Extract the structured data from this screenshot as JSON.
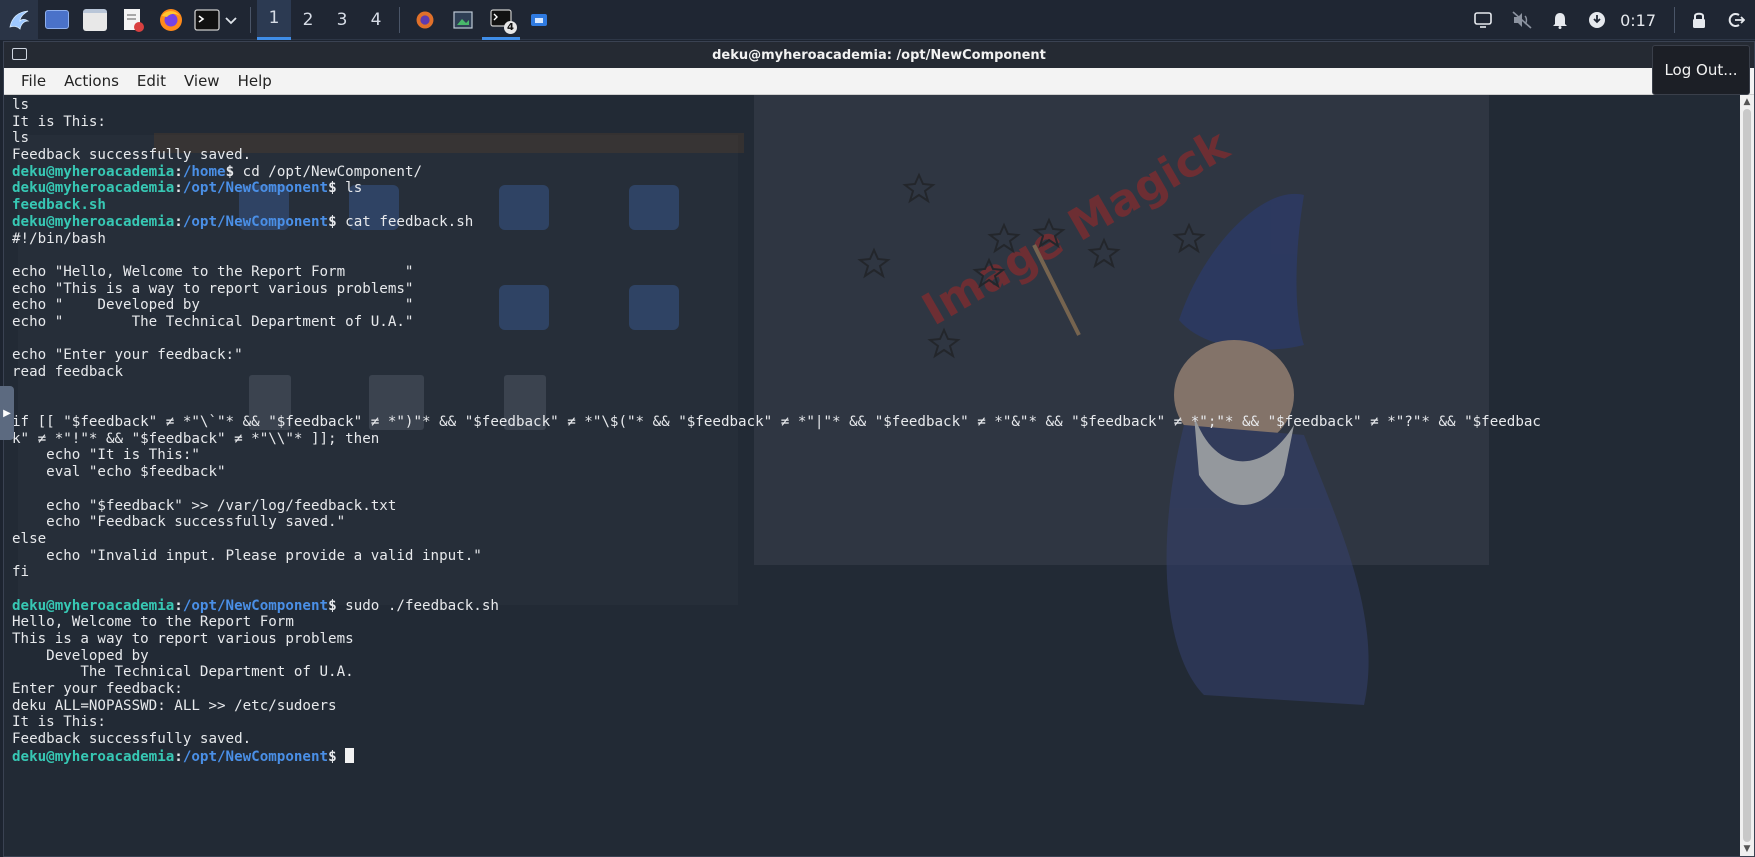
{
  "taskbar": {
    "workspaces": [
      "1",
      "2",
      "3",
      "4"
    ],
    "active_workspace": "1",
    "window_badge": "4",
    "clock": "0:17",
    "accent": "#3f8de8"
  },
  "window": {
    "title": "deku@myheroacademia: /opt/NewComponent",
    "menu": [
      "File",
      "Actions",
      "Edit",
      "View",
      "Help"
    ]
  },
  "tooltip": {
    "text": "Log Out..."
  },
  "wallpaper_text": "Image Magick",
  "terminal": {
    "prompt_user": "deku@myheroacademia",
    "lines": [
      {
        "type": "text",
        "text": "ls"
      },
      {
        "type": "text",
        "text": "It is This:"
      },
      {
        "type": "text",
        "text": "ls"
      },
      {
        "type": "text",
        "text": "Feedback successfully saved."
      },
      {
        "type": "prompt",
        "path": "/home",
        "cmd": "cd /opt/NewComponent/"
      },
      {
        "type": "prompt",
        "path": "/opt/NewComponent",
        "cmd": "ls"
      },
      {
        "type": "file",
        "text": "feedback.sh"
      },
      {
        "type": "prompt",
        "path": "/opt/NewComponent",
        "cmd": "cat feedback.sh"
      },
      {
        "type": "text",
        "text": "#!/bin/bash"
      },
      {
        "type": "text",
        "text": ""
      },
      {
        "type": "text",
        "text": "echo \"Hello, Welcome to the Report Form       \""
      },
      {
        "type": "text",
        "text": "echo \"This is a way to report various problems\""
      },
      {
        "type": "text",
        "text": "echo \"    Developed by                        \""
      },
      {
        "type": "text",
        "text": "echo \"        The Technical Department of U.A.\""
      },
      {
        "type": "text",
        "text": ""
      },
      {
        "type": "text",
        "text": "echo \"Enter your feedback:\""
      },
      {
        "type": "text",
        "text": "read feedback"
      },
      {
        "type": "text",
        "text": ""
      },
      {
        "type": "text",
        "text": ""
      },
      {
        "type": "text",
        "text": "if [[ \"$feedback\" ≠ *\"\\`\"* && \"$feedback\" ≠ *\")\"* && \"$feedback\" ≠ *\"\\$(\"* && \"$feedback\" ≠ *\"|\"* && \"$feedback\" ≠ *\"&\"* && \"$feedback\" ≠ *\";\"* && \"$feedback\" ≠ *\"?\"* && \"$feedbac"
      },
      {
        "type": "text",
        "text": "k\" ≠ *\"!\"* && \"$feedback\" ≠ *\"\\\\\"* ]]; then"
      },
      {
        "type": "text",
        "text": "    echo \"It is This:\""
      },
      {
        "type": "text",
        "text": "    eval \"echo $feedback\""
      },
      {
        "type": "text",
        "text": ""
      },
      {
        "type": "text",
        "text": "    echo \"$feedback\" >> /var/log/feedback.txt"
      },
      {
        "type": "text",
        "text": "    echo \"Feedback successfully saved.\""
      },
      {
        "type": "text",
        "text": "else"
      },
      {
        "type": "text",
        "text": "    echo \"Invalid input. Please provide a valid input.\""
      },
      {
        "type": "text",
        "text": "fi"
      },
      {
        "type": "text",
        "text": ""
      },
      {
        "type": "prompt",
        "path": "/opt/NewComponent",
        "cmd": "sudo ./feedback.sh"
      },
      {
        "type": "text",
        "text": "Hello, Welcome to the Report Form"
      },
      {
        "type": "text",
        "text": "This is a way to report various problems"
      },
      {
        "type": "text",
        "text": "    Developed by"
      },
      {
        "type": "text",
        "text": "        The Technical Department of U.A."
      },
      {
        "type": "text",
        "text": "Enter your feedback:"
      },
      {
        "type": "text",
        "text": "deku ALL=NOPASSWD: ALL >> /etc/sudoers"
      },
      {
        "type": "text",
        "text": "It is This:"
      },
      {
        "type": "text",
        "text": "Feedback successfully saved."
      },
      {
        "type": "prompt",
        "path": "/opt/NewComponent",
        "cmd": "",
        "cursor": true
      }
    ]
  }
}
